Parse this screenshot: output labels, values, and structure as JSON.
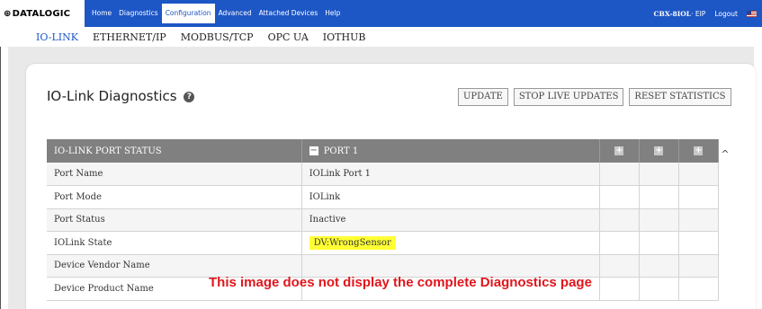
{
  "logo": {
    "text": "DATALOGIC",
    "mark": "⊕"
  },
  "topnav": {
    "items": [
      {
        "label": "Home"
      },
      {
        "label": "Diagnostics"
      },
      {
        "label": "Configuration",
        "active": true
      },
      {
        "label": "Advanced"
      },
      {
        "label": "Attached Devices"
      },
      {
        "label": "Help"
      }
    ],
    "device_name": "CBX-8IOL",
    "device_protocol": "· EIP",
    "logout": "Logout",
    "flag_icon": "us-flag-icon"
  },
  "subnav": {
    "items": [
      {
        "label": "IO-LINK",
        "active": true
      },
      {
        "label": "ETHERNET/IP"
      },
      {
        "label": "MODBUS/TCP"
      },
      {
        "label": "OPC UA"
      },
      {
        "label": "IOTHUB"
      }
    ]
  },
  "page": {
    "title": "IO-Link Diagnostics",
    "help_icon": "?"
  },
  "buttons": {
    "update": "UPDATE",
    "stop_live": "STOP LIVE UPDATES",
    "reset_stats": "RESET STATISTICS"
  },
  "table": {
    "header_label": "IO-LINK PORT STATUS",
    "port_header": "PORT 1",
    "collapse_icon": "−",
    "expand_icon": "+",
    "rows": [
      {
        "label": "Port Name",
        "value": "IOLink Port 1"
      },
      {
        "label": "Port Mode",
        "value": "IOLink"
      },
      {
        "label": "Port Status",
        "value": "Inactive"
      },
      {
        "label": "IOLink State",
        "value": "DV:WrongSensor",
        "highlight": true
      },
      {
        "label": "Device Vendor Name",
        "value": ""
      },
      {
        "label": "Device Product Name",
        "value": ""
      }
    ]
  },
  "note": "This image does not display the complete Diagnostics page",
  "colors": {
    "nav_blue": "#1d56c5",
    "header_gray": "#808080",
    "highlight_yellow": "#ffff33",
    "note_red": "#e0161c"
  }
}
